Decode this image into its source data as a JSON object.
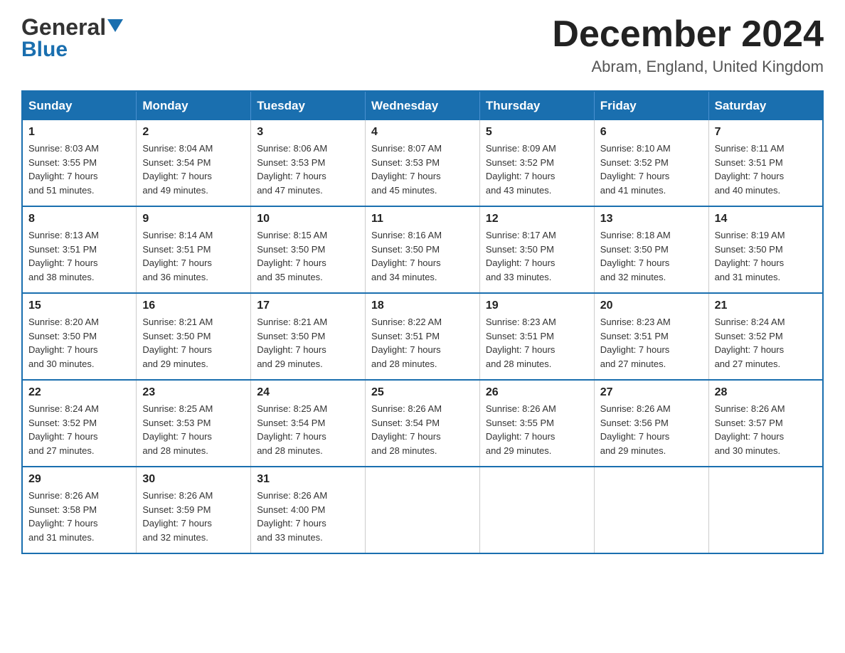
{
  "header": {
    "logo_general": "General",
    "logo_blue": "Blue",
    "month_title": "December 2024",
    "location": "Abram, England, United Kingdom"
  },
  "days_of_week": [
    "Sunday",
    "Monday",
    "Tuesday",
    "Wednesday",
    "Thursday",
    "Friday",
    "Saturday"
  ],
  "weeks": [
    [
      {
        "day": "1",
        "sunrise": "8:03 AM",
        "sunset": "3:55 PM",
        "daylight": "7 hours and 51 minutes."
      },
      {
        "day": "2",
        "sunrise": "8:04 AM",
        "sunset": "3:54 PM",
        "daylight": "7 hours and 49 minutes."
      },
      {
        "day": "3",
        "sunrise": "8:06 AM",
        "sunset": "3:53 PM",
        "daylight": "7 hours and 47 minutes."
      },
      {
        "day": "4",
        "sunrise": "8:07 AM",
        "sunset": "3:53 PM",
        "daylight": "7 hours and 45 minutes."
      },
      {
        "day": "5",
        "sunrise": "8:09 AM",
        "sunset": "3:52 PM",
        "daylight": "7 hours and 43 minutes."
      },
      {
        "day": "6",
        "sunrise": "8:10 AM",
        "sunset": "3:52 PM",
        "daylight": "7 hours and 41 minutes."
      },
      {
        "day": "7",
        "sunrise": "8:11 AM",
        "sunset": "3:51 PM",
        "daylight": "7 hours and 40 minutes."
      }
    ],
    [
      {
        "day": "8",
        "sunrise": "8:13 AM",
        "sunset": "3:51 PM",
        "daylight": "7 hours and 38 minutes."
      },
      {
        "day": "9",
        "sunrise": "8:14 AM",
        "sunset": "3:51 PM",
        "daylight": "7 hours and 36 minutes."
      },
      {
        "day": "10",
        "sunrise": "8:15 AM",
        "sunset": "3:50 PM",
        "daylight": "7 hours and 35 minutes."
      },
      {
        "day": "11",
        "sunrise": "8:16 AM",
        "sunset": "3:50 PM",
        "daylight": "7 hours and 34 minutes."
      },
      {
        "day": "12",
        "sunrise": "8:17 AM",
        "sunset": "3:50 PM",
        "daylight": "7 hours and 33 minutes."
      },
      {
        "day": "13",
        "sunrise": "8:18 AM",
        "sunset": "3:50 PM",
        "daylight": "7 hours and 32 minutes."
      },
      {
        "day": "14",
        "sunrise": "8:19 AM",
        "sunset": "3:50 PM",
        "daylight": "7 hours and 31 minutes."
      }
    ],
    [
      {
        "day": "15",
        "sunrise": "8:20 AM",
        "sunset": "3:50 PM",
        "daylight": "7 hours and 30 minutes."
      },
      {
        "day": "16",
        "sunrise": "8:21 AM",
        "sunset": "3:50 PM",
        "daylight": "7 hours and 29 minutes."
      },
      {
        "day": "17",
        "sunrise": "8:21 AM",
        "sunset": "3:50 PM",
        "daylight": "7 hours and 29 minutes."
      },
      {
        "day": "18",
        "sunrise": "8:22 AM",
        "sunset": "3:51 PM",
        "daylight": "7 hours and 28 minutes."
      },
      {
        "day": "19",
        "sunrise": "8:23 AM",
        "sunset": "3:51 PM",
        "daylight": "7 hours and 28 minutes."
      },
      {
        "day": "20",
        "sunrise": "8:23 AM",
        "sunset": "3:51 PM",
        "daylight": "7 hours and 27 minutes."
      },
      {
        "day": "21",
        "sunrise": "8:24 AM",
        "sunset": "3:52 PM",
        "daylight": "7 hours and 27 minutes."
      }
    ],
    [
      {
        "day": "22",
        "sunrise": "8:24 AM",
        "sunset": "3:52 PM",
        "daylight": "7 hours and 27 minutes."
      },
      {
        "day": "23",
        "sunrise": "8:25 AM",
        "sunset": "3:53 PM",
        "daylight": "7 hours and 28 minutes."
      },
      {
        "day": "24",
        "sunrise": "8:25 AM",
        "sunset": "3:54 PM",
        "daylight": "7 hours and 28 minutes."
      },
      {
        "day": "25",
        "sunrise": "8:26 AM",
        "sunset": "3:54 PM",
        "daylight": "7 hours and 28 minutes."
      },
      {
        "day": "26",
        "sunrise": "8:26 AM",
        "sunset": "3:55 PM",
        "daylight": "7 hours and 29 minutes."
      },
      {
        "day": "27",
        "sunrise": "8:26 AM",
        "sunset": "3:56 PM",
        "daylight": "7 hours and 29 minutes."
      },
      {
        "day": "28",
        "sunrise": "8:26 AM",
        "sunset": "3:57 PM",
        "daylight": "7 hours and 30 minutes."
      }
    ],
    [
      {
        "day": "29",
        "sunrise": "8:26 AM",
        "sunset": "3:58 PM",
        "daylight": "7 hours and 31 minutes."
      },
      {
        "day": "30",
        "sunrise": "8:26 AM",
        "sunset": "3:59 PM",
        "daylight": "7 hours and 32 minutes."
      },
      {
        "day": "31",
        "sunrise": "8:26 AM",
        "sunset": "4:00 PM",
        "daylight": "7 hours and 33 minutes."
      },
      null,
      null,
      null,
      null
    ]
  ],
  "labels": {
    "sunrise": "Sunrise:",
    "sunset": "Sunset:",
    "daylight": "Daylight:"
  }
}
